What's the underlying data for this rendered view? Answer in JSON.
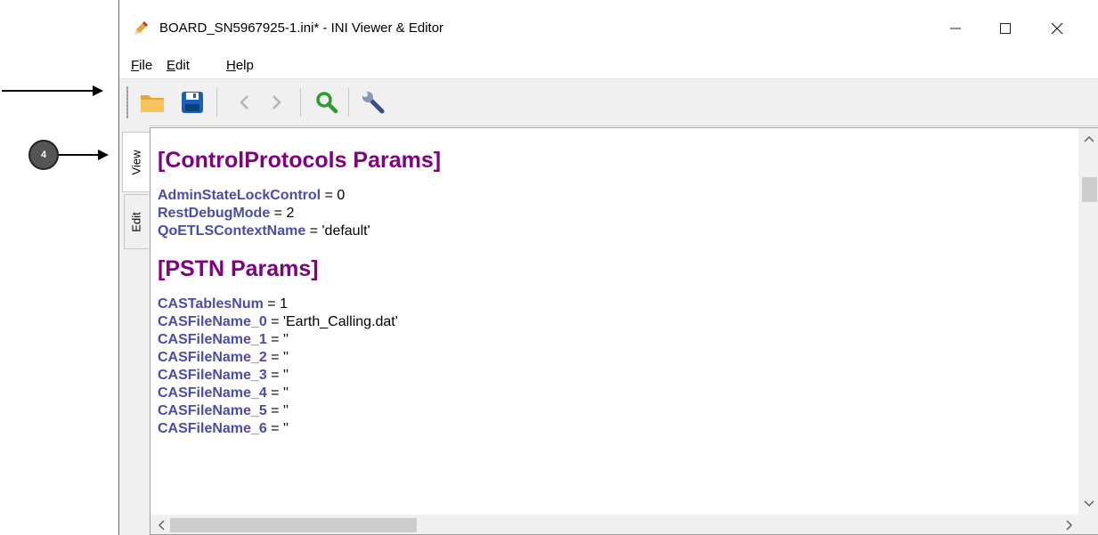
{
  "window": {
    "title": "BOARD_SN5967925-1.ini* - INI Viewer & Editor",
    "minimize": "—",
    "maximize": "☐",
    "close": "✕"
  },
  "menu": [
    {
      "label": "File",
      "mnemonic": "F",
      "rest": "ile"
    },
    {
      "label": "Edit",
      "mnemonic": "E",
      "rest": "dit"
    },
    {
      "label": "Help",
      "mnemonic": "H",
      "rest": "elp"
    }
  ],
  "toolbar": {
    "icons": [
      "open-folder-icon",
      "save-icon",
      "back-icon",
      "forward-icon",
      "search-icon",
      "settings-wrench-icon"
    ]
  },
  "tabs": {
    "view": "View",
    "edit": "Edit",
    "active": "View"
  },
  "annotation": {
    "callout_number": "4"
  },
  "document": {
    "sections": [
      {
        "name": "[ControlProtocols Params]",
        "entries": [
          {
            "key": "AdminStateLockControl",
            "value": " = 0"
          },
          {
            "key": "RestDebugMode",
            "value": " = 2"
          },
          {
            "key": "QoETLSContextName",
            "value": " = 'default'"
          }
        ]
      },
      {
        "name": "[PSTN Params]",
        "entries": [
          {
            "key": "CASTablesNum",
            "value": " = 1"
          },
          {
            "key": "CASFileName_0",
            "value": " = 'Earth_Calling.dat'"
          },
          {
            "key": "CASFileName_1",
            "value": " = ''"
          },
          {
            "key": "CASFileName_2",
            "value": " = ''"
          },
          {
            "key": "CASFileName_3",
            "value": " = ''"
          },
          {
            "key": "CASFileName_4",
            "value": " = ''"
          },
          {
            "key": "CASFileName_5",
            "value": " = ''"
          },
          {
            "key": "CASFileName_6",
            "value": " = ''"
          }
        ]
      }
    ]
  },
  "colors": {
    "section": "#800080",
    "key": "#4b4ba8",
    "value": "#000000"
  }
}
